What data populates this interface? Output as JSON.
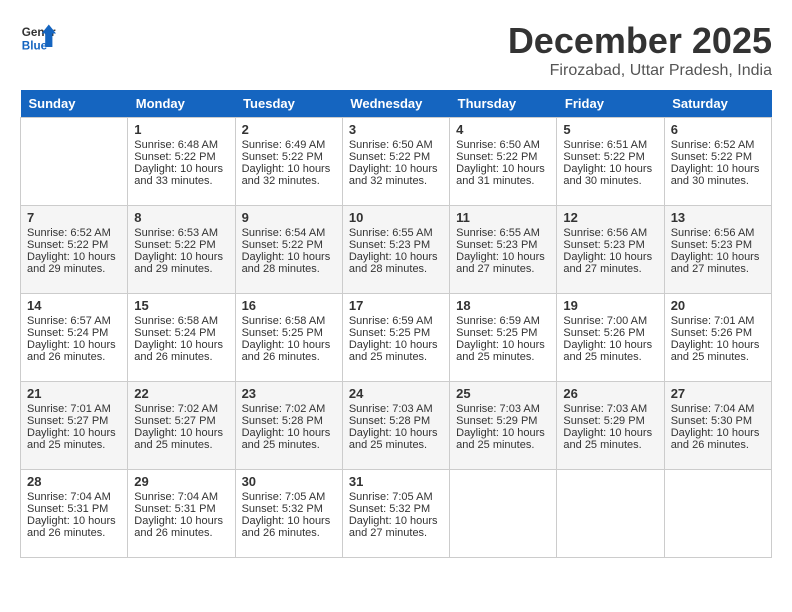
{
  "header": {
    "logo_line1": "General",
    "logo_line2": "Blue",
    "month": "December 2025",
    "location": "Firozabad, Uttar Pradesh, India"
  },
  "weekdays": [
    "Sunday",
    "Monday",
    "Tuesday",
    "Wednesday",
    "Thursday",
    "Friday",
    "Saturday"
  ],
  "weeks": [
    [
      {
        "day": "",
        "info": ""
      },
      {
        "day": "1",
        "info": "Sunrise: 6:48 AM\nSunset: 5:22 PM\nDaylight: 10 hours\nand 33 minutes."
      },
      {
        "day": "2",
        "info": "Sunrise: 6:49 AM\nSunset: 5:22 PM\nDaylight: 10 hours\nand 32 minutes."
      },
      {
        "day": "3",
        "info": "Sunrise: 6:50 AM\nSunset: 5:22 PM\nDaylight: 10 hours\nand 32 minutes."
      },
      {
        "day": "4",
        "info": "Sunrise: 6:50 AM\nSunset: 5:22 PM\nDaylight: 10 hours\nand 31 minutes."
      },
      {
        "day": "5",
        "info": "Sunrise: 6:51 AM\nSunset: 5:22 PM\nDaylight: 10 hours\nand 30 minutes."
      },
      {
        "day": "6",
        "info": "Sunrise: 6:52 AM\nSunset: 5:22 PM\nDaylight: 10 hours\nand 30 minutes."
      }
    ],
    [
      {
        "day": "7",
        "info": "Sunrise: 6:52 AM\nSunset: 5:22 PM\nDaylight: 10 hours\nand 29 minutes."
      },
      {
        "day": "8",
        "info": "Sunrise: 6:53 AM\nSunset: 5:22 PM\nDaylight: 10 hours\nand 29 minutes."
      },
      {
        "day": "9",
        "info": "Sunrise: 6:54 AM\nSunset: 5:22 PM\nDaylight: 10 hours\nand 28 minutes."
      },
      {
        "day": "10",
        "info": "Sunrise: 6:55 AM\nSunset: 5:23 PM\nDaylight: 10 hours\nand 28 minutes."
      },
      {
        "day": "11",
        "info": "Sunrise: 6:55 AM\nSunset: 5:23 PM\nDaylight: 10 hours\nand 27 minutes."
      },
      {
        "day": "12",
        "info": "Sunrise: 6:56 AM\nSunset: 5:23 PM\nDaylight: 10 hours\nand 27 minutes."
      },
      {
        "day": "13",
        "info": "Sunrise: 6:56 AM\nSunset: 5:23 PM\nDaylight: 10 hours\nand 27 minutes."
      }
    ],
    [
      {
        "day": "14",
        "info": "Sunrise: 6:57 AM\nSunset: 5:24 PM\nDaylight: 10 hours\nand 26 minutes."
      },
      {
        "day": "15",
        "info": "Sunrise: 6:58 AM\nSunset: 5:24 PM\nDaylight: 10 hours\nand 26 minutes."
      },
      {
        "day": "16",
        "info": "Sunrise: 6:58 AM\nSunset: 5:25 PM\nDaylight: 10 hours\nand 26 minutes."
      },
      {
        "day": "17",
        "info": "Sunrise: 6:59 AM\nSunset: 5:25 PM\nDaylight: 10 hours\nand 25 minutes."
      },
      {
        "day": "18",
        "info": "Sunrise: 6:59 AM\nSunset: 5:25 PM\nDaylight: 10 hours\nand 25 minutes."
      },
      {
        "day": "19",
        "info": "Sunrise: 7:00 AM\nSunset: 5:26 PM\nDaylight: 10 hours\nand 25 minutes."
      },
      {
        "day": "20",
        "info": "Sunrise: 7:01 AM\nSunset: 5:26 PM\nDaylight: 10 hours\nand 25 minutes."
      }
    ],
    [
      {
        "day": "21",
        "info": "Sunrise: 7:01 AM\nSunset: 5:27 PM\nDaylight: 10 hours\nand 25 minutes."
      },
      {
        "day": "22",
        "info": "Sunrise: 7:02 AM\nSunset: 5:27 PM\nDaylight: 10 hours\nand 25 minutes."
      },
      {
        "day": "23",
        "info": "Sunrise: 7:02 AM\nSunset: 5:28 PM\nDaylight: 10 hours\nand 25 minutes."
      },
      {
        "day": "24",
        "info": "Sunrise: 7:03 AM\nSunset: 5:28 PM\nDaylight: 10 hours\nand 25 minutes."
      },
      {
        "day": "25",
        "info": "Sunrise: 7:03 AM\nSunset: 5:29 PM\nDaylight: 10 hours\nand 25 minutes."
      },
      {
        "day": "26",
        "info": "Sunrise: 7:03 AM\nSunset: 5:29 PM\nDaylight: 10 hours\nand 25 minutes."
      },
      {
        "day": "27",
        "info": "Sunrise: 7:04 AM\nSunset: 5:30 PM\nDaylight: 10 hours\nand 26 minutes."
      }
    ],
    [
      {
        "day": "28",
        "info": "Sunrise: 7:04 AM\nSunset: 5:31 PM\nDaylight: 10 hours\nand 26 minutes."
      },
      {
        "day": "29",
        "info": "Sunrise: 7:04 AM\nSunset: 5:31 PM\nDaylight: 10 hours\nand 26 minutes."
      },
      {
        "day": "30",
        "info": "Sunrise: 7:05 AM\nSunset: 5:32 PM\nDaylight: 10 hours\nand 26 minutes."
      },
      {
        "day": "31",
        "info": "Sunrise: 7:05 AM\nSunset: 5:32 PM\nDaylight: 10 hours\nand 27 minutes."
      },
      {
        "day": "",
        "info": ""
      },
      {
        "day": "",
        "info": ""
      },
      {
        "day": "",
        "info": ""
      }
    ]
  ]
}
